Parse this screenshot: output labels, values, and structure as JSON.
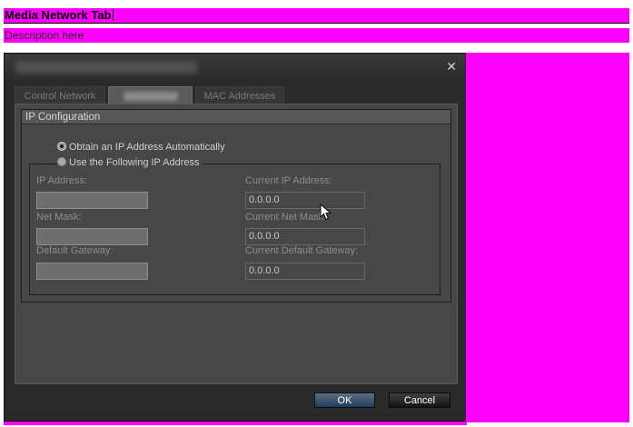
{
  "document": {
    "title": "Media Network Tab",
    "description": "Description here"
  },
  "dialog": {
    "close_icon": "close-icon",
    "tabs": [
      {
        "label": "Control Network"
      },
      {
        "label": ""
      },
      {
        "label": "MAC Addresses"
      }
    ],
    "ip_config": {
      "header": "IP Configuration",
      "option_auto": "Obtain an IP Address Automatically",
      "option_manual": "Use the Following IP Address",
      "ip_label": "IP Address:",
      "mask_label": "Net Mask:",
      "gateway_label": "Default Gateway:",
      "current_ip_label": "Current IP Address:",
      "current_ip_value": "0.0.0.0",
      "current_mask_label": "Current Net Mask:",
      "current_mask_value": "0.0.0.0",
      "current_gateway_label": "Current Default Gateway:",
      "current_gateway_value": "0.0.0.0"
    },
    "buttons": {
      "ok": "OK",
      "cancel": "Cancel"
    }
  },
  "colors": {
    "highlight": "#ff00ff",
    "dialog_bg": "#2a2a2a",
    "panel_bg": "#474747"
  }
}
